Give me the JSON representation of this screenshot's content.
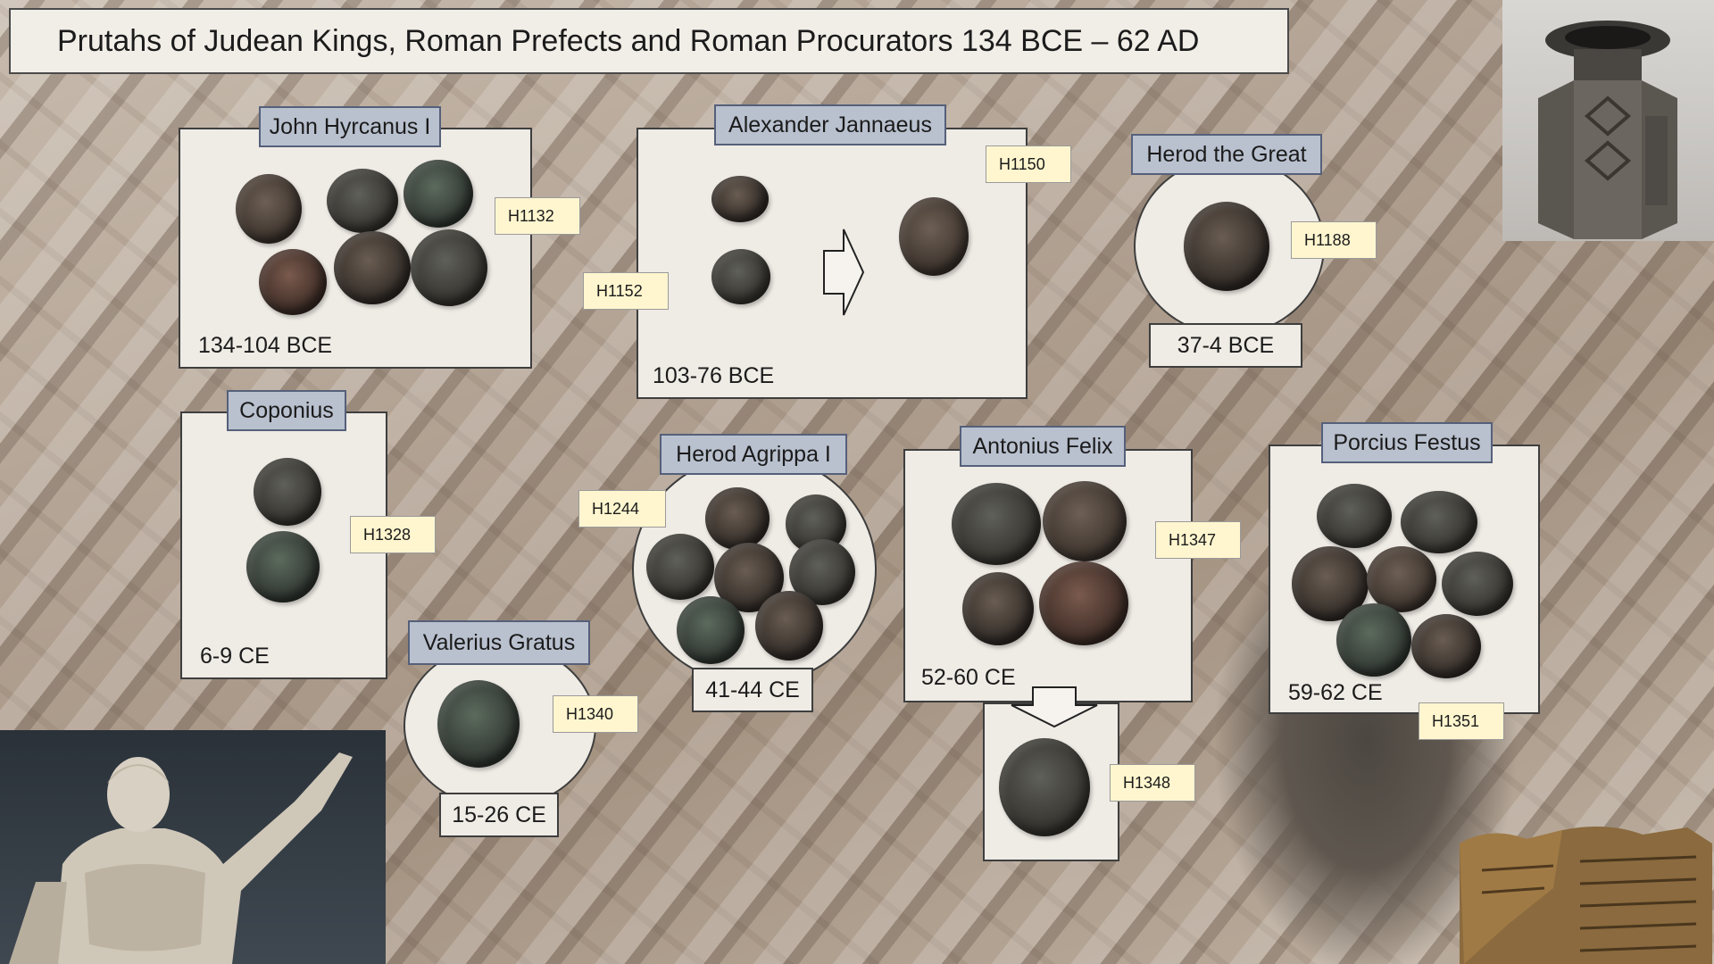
{
  "title": "Prutahs of Judean Kings, Roman Prefects and Roman Procurators 134 BCE – 62 AD",
  "rulers": {
    "hyrcanus": {
      "name": "John Hyrcanus I",
      "dates": "134-104 BCE",
      "ref": "H1132"
    },
    "jannaeus": {
      "name": "Alexander Jannaeus",
      "dates": "103-76 BCE",
      "ref_a": "H1152",
      "ref_b": "H1150"
    },
    "herod": {
      "name": "Herod the Great",
      "dates": "37-4 BCE",
      "ref": "H1188"
    },
    "coponius": {
      "name": "Coponius",
      "dates": "6-9 CE",
      "ref": "H1328"
    },
    "agrippa": {
      "name": "Herod Agrippa I",
      "dates": "41-44 CE",
      "ref": "H1244"
    },
    "felix": {
      "name": "Antonius Felix",
      "dates": "52-60 CE",
      "ref_a": "H1347",
      "ref_b": "H1348"
    },
    "festus": {
      "name": "Porcius Festus",
      "dates": "59-62 CE",
      "ref": "H1351"
    },
    "gratus": {
      "name": "Valerius Gratus",
      "dates": "15-26 CE",
      "ref": "H1340"
    }
  },
  "icons": [
    "arrow-right-icon",
    "arrow-down-icon"
  ],
  "colors": {
    "name_tag": "#b9c1cf",
    "ref_tag": "#fff6cf",
    "panel": "#efebe5"
  }
}
